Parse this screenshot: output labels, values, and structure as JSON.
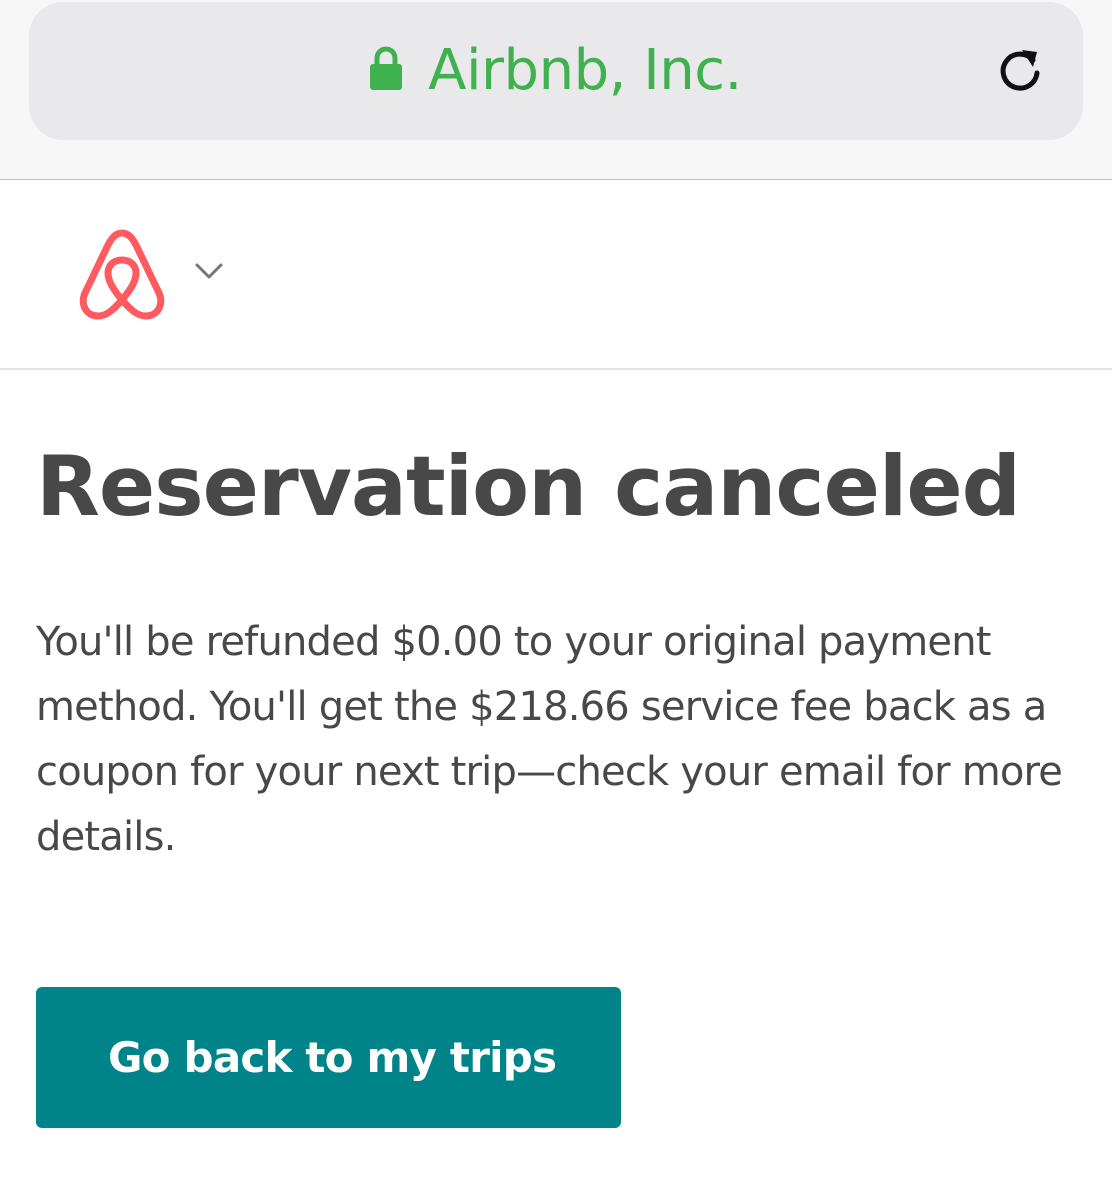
{
  "browser": {
    "site_name": "Airbnb, Inc.",
    "lock_icon": "lock-icon",
    "reload_icon": "reload-icon",
    "secure_color": "#3fb24f"
  },
  "header": {
    "logo_icon": "airbnb-logo-icon",
    "menu_icon": "chevron-down-icon",
    "brand_color": "#ff5a5f"
  },
  "main": {
    "title": "Reservation canceled",
    "message": "You'll be refunded $0.00 to your original payment method. You'll get the $218.66 service fee back as a coupon for your next trip—check your email for more details.",
    "button_label": "Go back to my trips",
    "button_color": "#008489"
  }
}
